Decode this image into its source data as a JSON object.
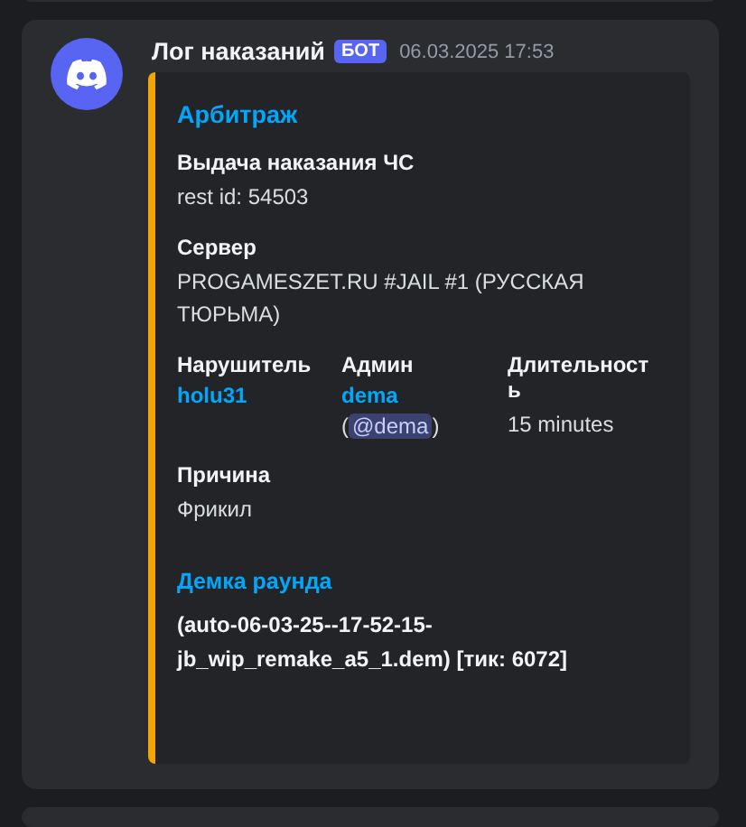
{
  "message": {
    "author": "Лог наказаний",
    "badge": "БОТ",
    "timestamp": "06.03.2025 17:53",
    "embed": {
      "color": "#f0a500",
      "title": "Арбитраж",
      "fields": [
        {
          "name": "Выдача наказания ЧС",
          "value": "rest id: 54503",
          "inline": false,
          "kind": "text"
        },
        {
          "name": "Сервер",
          "value": "PROGAMESZET.RU #JAIL #1 (РУССКАЯ ТЮРЬМА)",
          "inline": false,
          "kind": "text"
        },
        {
          "name": "Нарушитель",
          "value": "holu31",
          "inline": true,
          "kind": "link"
        },
        {
          "name": "Админ",
          "value": "dema",
          "mention": "@dema",
          "open_paren": "(",
          "close_paren": ")",
          "inline": true,
          "kind": "user"
        },
        {
          "name": "Длительность",
          "value": "15 minutes",
          "inline": true,
          "kind": "text"
        },
        {
          "name": "Причина",
          "value": "Фрикил",
          "inline": false,
          "kind": "text"
        }
      ],
      "footer_title": "Демка раунда",
      "footer_text": "(auto-06-03-25--17-52-15-jb_wip_remake_a5_1.dem) [тик: 6072]"
    }
  }
}
